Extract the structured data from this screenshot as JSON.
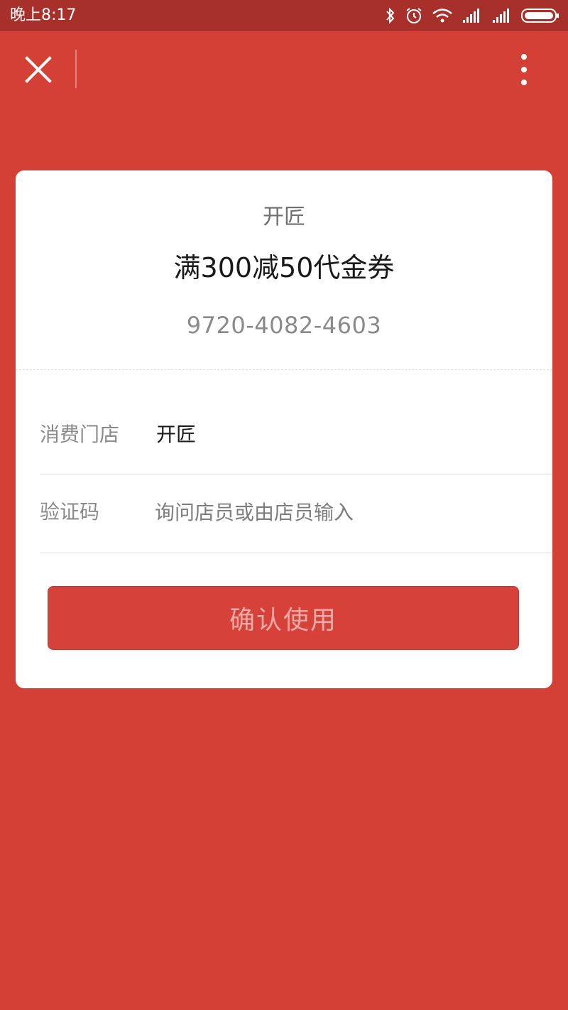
{
  "status_bar": {
    "time": "晚上8:17",
    "icons": [
      "bluetooth-icon",
      "alarm-icon",
      "wifi-icon",
      "signal-icon",
      "signal-icon",
      "battery-icon"
    ]
  },
  "nav_bar": {
    "close_icon": "close-icon",
    "more_icon": "more-vertical-icon"
  },
  "coupon": {
    "merchant": "开匠",
    "title": "满300减50代金券",
    "code": "9720-4082-4603"
  },
  "form": {
    "store_label": "消费门店",
    "store_value": "开匠",
    "verify_label": "验证码",
    "verify_placeholder": "询问店员或由店员输入",
    "verify_value": ""
  },
  "confirm_button": {
    "label": "确认使用"
  },
  "colors": {
    "background": "#d54036",
    "status_bar": "#a8302a",
    "card": "#ffffff",
    "button": "#d6423a"
  }
}
